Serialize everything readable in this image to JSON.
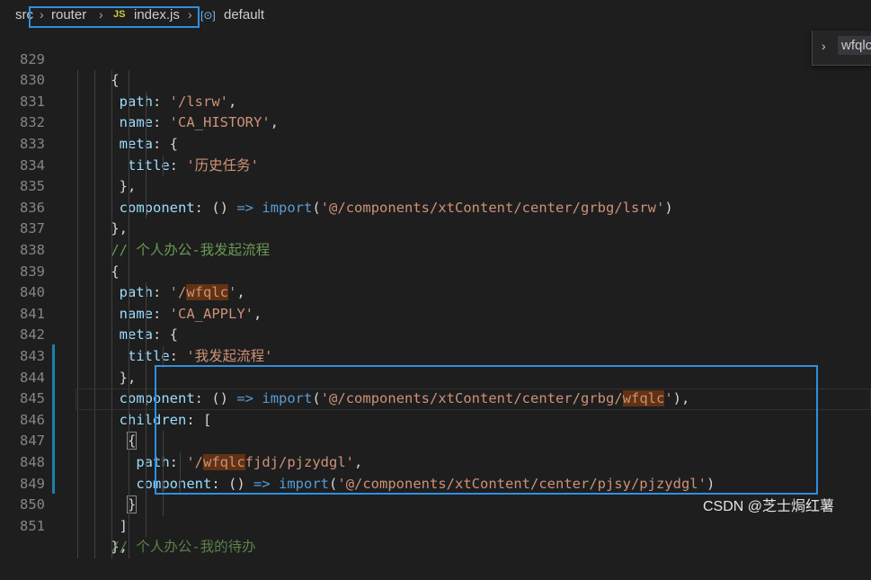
{
  "breadcrumb": {
    "items": [
      "src",
      "router",
      "index.js",
      "default"
    ],
    "file_badge": "JS",
    "symbol_icon": "symbol-icon"
  },
  "peek": {
    "text": "wfqlc"
  },
  "editor": {
    "lines": [
      {
        "num": "829"
      },
      {
        "num": "830"
      },
      {
        "num": "831"
      },
      {
        "num": "832"
      },
      {
        "num": "833"
      },
      {
        "num": "834"
      },
      {
        "num": "835"
      },
      {
        "num": "836"
      },
      {
        "num": "837"
      },
      {
        "num": "838"
      },
      {
        "num": "839"
      },
      {
        "num": "840"
      },
      {
        "num": "841"
      },
      {
        "num": "842"
      },
      {
        "num": "843"
      },
      {
        "num": "844"
      },
      {
        "num": "845"
      },
      {
        "num": "846"
      },
      {
        "num": "847"
      },
      {
        "num": "848"
      },
      {
        "num": "849"
      },
      {
        "num": "850"
      },
      {
        "num": "851"
      }
    ],
    "tokens": {
      "open_brace": "{",
      "close_brace": "}",
      "close_brace_comma": "},",
      "path_key": "path",
      "name_key": "name",
      "meta_key": "meta",
      "title_key": "title",
      "component_key": "component",
      "children_key": "children",
      "colon": ": ",
      "comma": ",",
      "lsrw_path": "'/lsrw'",
      "ca_history": "'CA_HISTORY'",
      "title_history": "'历史任务'",
      "arrow_prefix": "() ",
      "arrow": "=>",
      "import_kw": "import",
      "lsrw_import": "'@/components/xtContent/center/grbg/lsrw'",
      "comment_wfqlc": "// 个人办公-我发起流程",
      "path_q_open": "'/",
      "wfqlc": "wfqlc",
      "q_close": "'",
      "ca_apply": "'CA_APPLY'",
      "title_apply": "'我发起流程'",
      "wfqlc_import_prefix": "'@/components/xtContent/center/grbg/",
      "children_open": "[",
      "children_close": "]",
      "child_path_suffix": "fjdj/pjzydgl'",
      "pjzydgl_import": "'@/components/xtContent/center/pjsy/pjzydgl'",
      "next_comment": "// 个人办公-我的待办"
    }
  },
  "watermark": "CSDN @芝士焗红薯"
}
